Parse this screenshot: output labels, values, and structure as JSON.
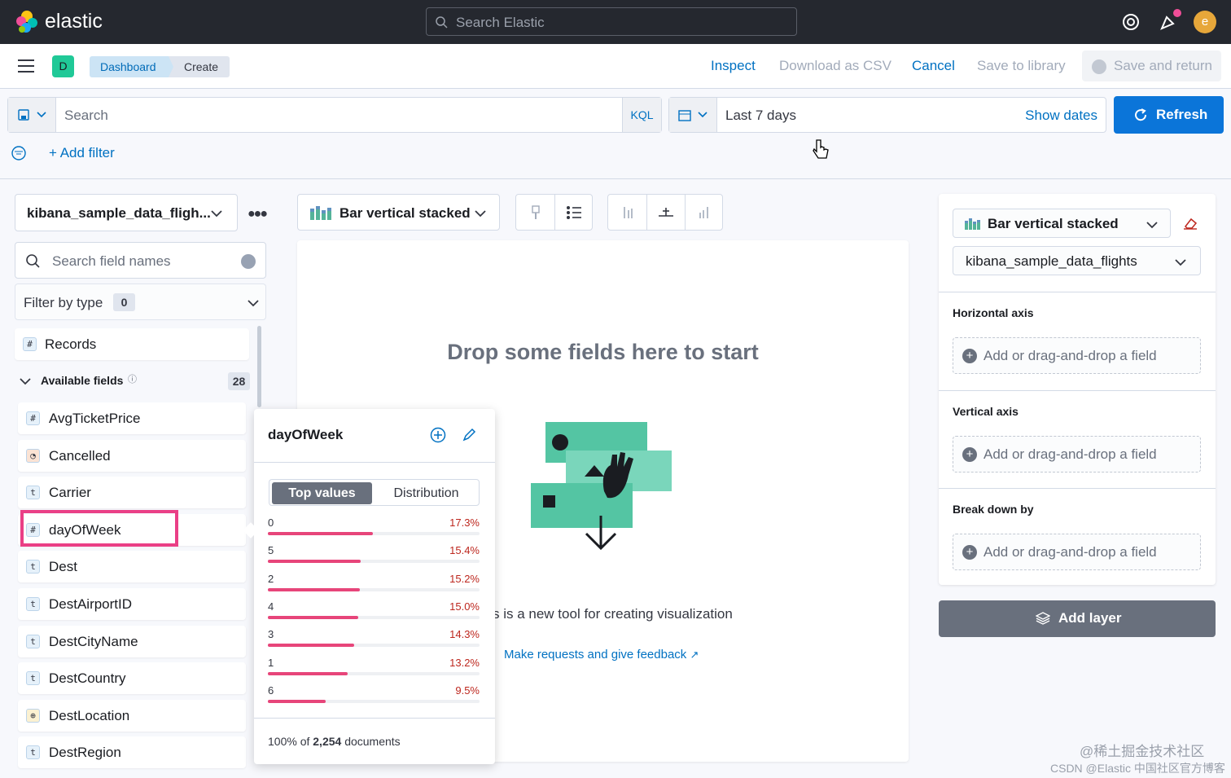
{
  "topbar": {
    "brand": "elastic",
    "search_placeholder": "Search Elastic",
    "avatar_letter": "e"
  },
  "header": {
    "space_letter": "D",
    "breadcrumbs": [
      "Dashboard",
      "Create"
    ],
    "links": {
      "inspect": "Inspect",
      "download_csv": "Download as CSV",
      "cancel": "Cancel",
      "save_library": "Save to library",
      "save_return": "Save and return"
    }
  },
  "query": {
    "search_placeholder": "Search",
    "language": "KQL",
    "time_range": "Last 7 days",
    "show_dates": "Show dates",
    "refresh": "Refresh",
    "add_filter": "+ Add filter"
  },
  "sidebar": {
    "index_pattern": "kibana_sample_data_fligh...",
    "field_search_placeholder": "Search field names",
    "filter_by_type": "Filter by type",
    "filter_count": "0",
    "records_label": "Records",
    "available_label": "Available fields",
    "available_count": "28",
    "fields": [
      {
        "name": "AvgTicketPrice",
        "type": "#"
      },
      {
        "name": "Cancelled",
        "type": "b"
      },
      {
        "name": "Carrier",
        "type": "t"
      },
      {
        "name": "dayOfWeek",
        "type": "#"
      },
      {
        "name": "Dest",
        "type": "t"
      },
      {
        "name": "DestAirportID",
        "type": "t"
      },
      {
        "name": "DestCityName",
        "type": "t"
      },
      {
        "name": "DestCountry",
        "type": "t"
      },
      {
        "name": "DestLocation",
        "type": "geo"
      },
      {
        "name": "DestRegion",
        "type": "t"
      }
    ]
  },
  "workspace": {
    "viz_type": "Bar vertical stacked",
    "drop_title": "Drop some fields here to start",
    "new_tool_text": "s is a new tool for creating visualization",
    "feedback_link": "Make requests and give feedback"
  },
  "popover": {
    "field_name": "dayOfWeek",
    "tab_top_values": "Top values",
    "tab_distribution": "Distribution",
    "top_values": [
      {
        "key": "0",
        "percent": "17.3%",
        "fraction": 0.173
      },
      {
        "key": "5",
        "percent": "15.4%",
        "fraction": 0.154
      },
      {
        "key": "2",
        "percent": "15.2%",
        "fraction": 0.152
      },
      {
        "key": "4",
        "percent": "15.0%",
        "fraction": 0.15
      },
      {
        "key": "3",
        "percent": "14.3%",
        "fraction": 0.143
      },
      {
        "key": "1",
        "percent": "13.2%",
        "fraction": 0.132
      },
      {
        "key": "6",
        "percent": "9.5%",
        "fraction": 0.095
      }
    ],
    "footer_prefix": "100% of ",
    "footer_count": "2,254",
    "footer_suffix": " documents"
  },
  "config_panel": {
    "viz_type": "Bar vertical stacked",
    "index_pattern": "kibana_sample_data_flights",
    "horizontal_axis": "Horizontal axis",
    "vertical_axis": "Vertical axis",
    "break_down_by": "Break down by",
    "drop_hint": "Add or drag-and-drop a field",
    "add_layer": "Add layer"
  },
  "watermark": {
    "line1": "@稀土掘金技术社区",
    "line2": "CSDN @Elastic 中国社区官方博客"
  },
  "colors": {
    "accent": "#0b75d9",
    "topbar": "#25282f",
    "bar_fill": "#e7457a",
    "highlight": "#ea3f86"
  }
}
